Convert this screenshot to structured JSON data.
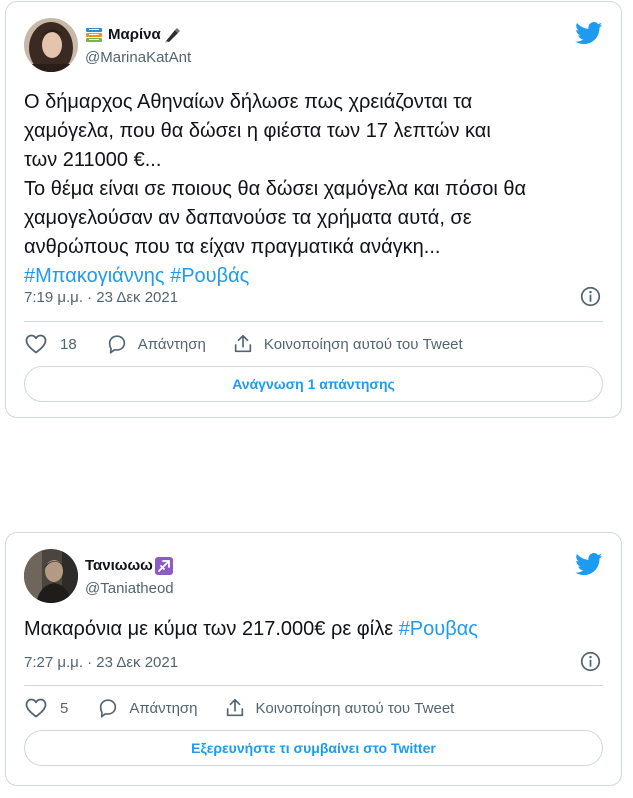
{
  "colors": {
    "accent": "#1d9bf0",
    "text": "#0f1419",
    "secondary": "#536471",
    "border": "#cfd9de"
  },
  "tweet1": {
    "display_name": "Μαρίνα",
    "name_emoji_before": "books-emoji",
    "name_emoji_after": "pen-emoji",
    "handle": "@MarinaKatAnt",
    "text_lines": [
      "Ο δήμαρχος Αθηναίων δήλωσε πως χρειάζονται τα",
      "χαμόγελα, που θα δώσει η φιέστα των 17 λεπτών και",
      "των 211000 €...",
      "Το θέμα είναι σε ποιους θα δώσει χαμόγελα και πόσοι θα",
      "χαμογελούσαν αν δαπανούσε τα χρήματα αυτά, σε",
      "ανθρώπους που τα είχαν πραγματικά ανάγκη..."
    ],
    "hashtags": [
      "#Μπακογιάννης",
      "#Ρουβάς"
    ],
    "timestamp": "7:19 μ.μ. · 23 Δεκ 2021",
    "likes": "18",
    "reply_label": "Απάντηση",
    "share_label": "Κοινοποίηση αυτού του Tweet",
    "cta_label": "Ανάγνωση 1 απάντησης"
  },
  "tweet2": {
    "display_name": "Τανιωωω",
    "name_emoji_after": "sagittarius-emoji",
    "handle": "@Taniatheod",
    "text_plain": "Μακαρόνια με κύμα των 217.000€ ρε φίλε ",
    "hashtag": "#Ρουβας",
    "timestamp": "7:27 μ.μ. · 23 Δεκ 2021",
    "likes": "5",
    "reply_label": "Απάντηση",
    "share_label": "Κοινοποίηση αυτού του Tweet",
    "cta_label": "Εξερευνήστε τι συμβαίνει στο Twitter"
  }
}
